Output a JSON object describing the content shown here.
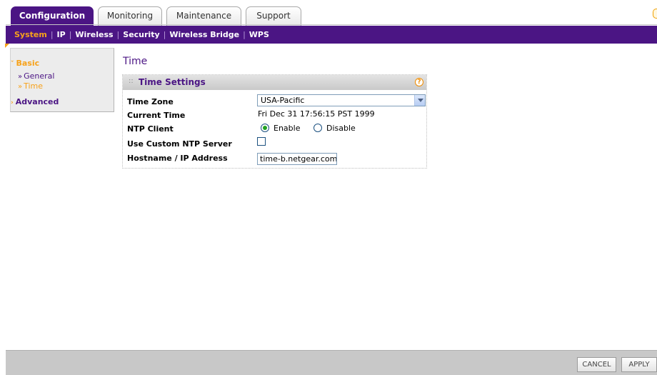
{
  "tabs": [
    {
      "label": "Configuration",
      "active": true
    },
    {
      "label": "Monitoring",
      "active": false
    },
    {
      "label": "Maintenance",
      "active": false
    },
    {
      "label": "Support",
      "active": false
    }
  ],
  "subnav": {
    "items": [
      {
        "label": "System",
        "active": true
      },
      {
        "label": "IP",
        "active": false
      },
      {
        "label": "Wireless",
        "active": false
      },
      {
        "label": "Security",
        "active": false
      },
      {
        "label": "Wireless Bridge",
        "active": false
      },
      {
        "label": "WPS",
        "active": false
      }
    ],
    "separator": "|"
  },
  "sidebar": {
    "basic": "Basic",
    "general": "General",
    "time": "Time",
    "advanced": "Advanced"
  },
  "page": {
    "title": "Time"
  },
  "panel": {
    "title": "Time Settings",
    "help_glyph": "?",
    "time_zone_label": "Time Zone",
    "time_zone_value": "USA-Pacific",
    "current_time_label": "Current Time",
    "current_time_value": "Fri Dec 31 17:56:15 PST 1999",
    "ntp_client_label": "NTP Client",
    "enable_label": "Enable",
    "disable_label": "Disable",
    "ntp_enabled": true,
    "custom_ntp_label": "Use Custom NTP Server",
    "custom_ntp_checked": false,
    "hostname_label": "Hostname / IP Address",
    "hostname_value": "time-b.netgear.com"
  },
  "buttons": {
    "cancel": "CANCEL",
    "apply": "APPLY"
  },
  "colors": {
    "brand_purple": "#4b1584",
    "accent_orange": "#f7a21b"
  }
}
